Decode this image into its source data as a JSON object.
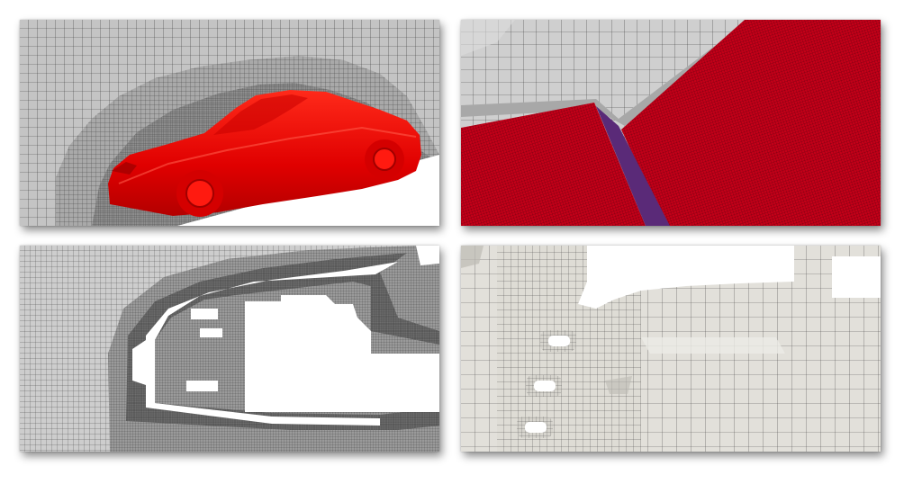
{
  "figure": {
    "panels": [
      {
        "subject": "car-exterior-mesh"
      },
      {
        "subject": "surface-mesh-closeup"
      },
      {
        "subject": "cross-section-mesh"
      },
      {
        "subject": "refined-detail-mesh"
      }
    ]
  },
  "colors": {
    "background": "#ffffff",
    "mesh_cell": "#c9c9c9",
    "mesh_line": "#3a3a3a",
    "car_body": "#ff0000",
    "surface_red": "#c8001a",
    "seam_purple": "#5a2a78",
    "pale_cell": "#e2e0da"
  }
}
